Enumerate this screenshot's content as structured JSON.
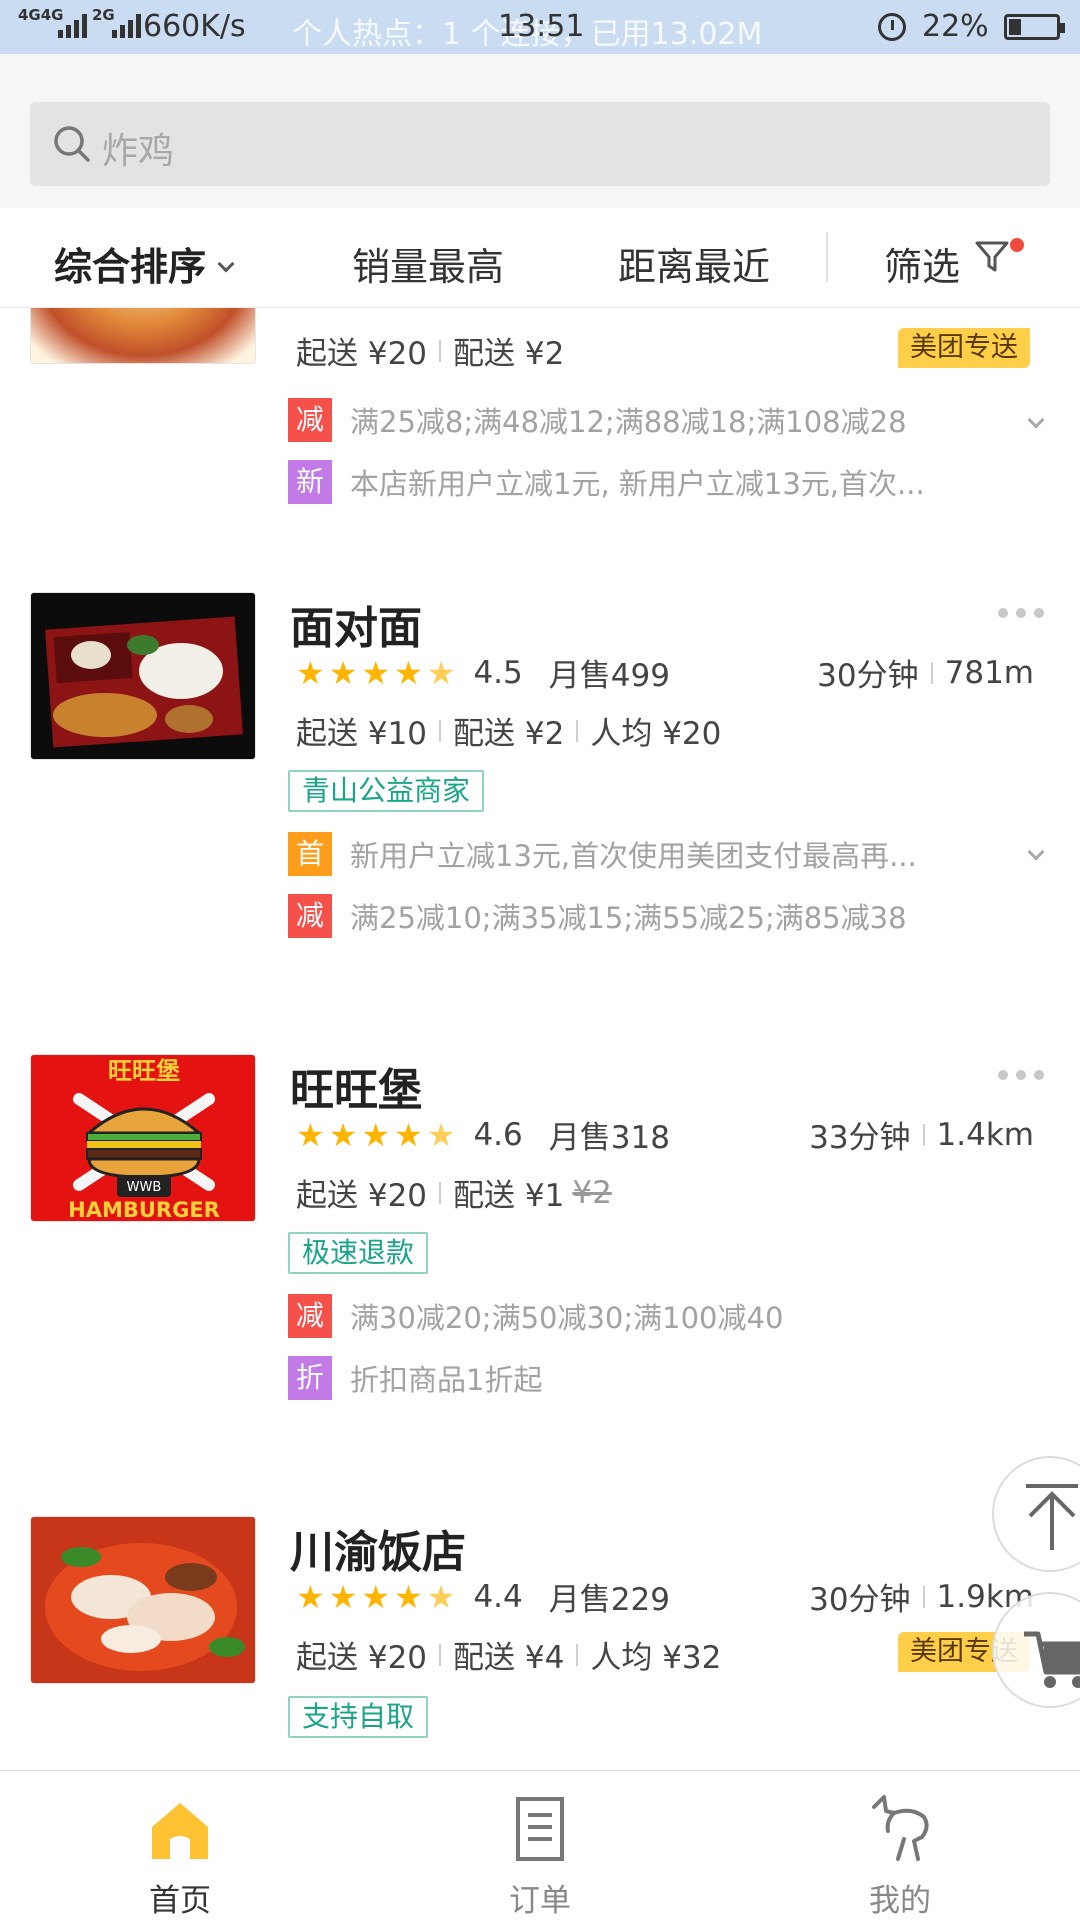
{
  "status_bar": {
    "network": "4G4G",
    "network2": "2G",
    "speed": "660K/s",
    "hotspot": "个人热点：1 个连接，已用13.02M",
    "time": "13:51",
    "battery": "22%"
  },
  "search": {
    "placeholder": "炸鸡"
  },
  "filters": {
    "sort": "综合排序",
    "sales": "销量最高",
    "distance": "距离最近",
    "filter": "筛选"
  },
  "shops": [
    {
      "name": "",
      "min_order": "起送 ¥20",
      "delivery": "配送 ¥2",
      "badge": "美团专送",
      "promos": [
        {
          "icon": "减",
          "text": "满25减8;满48减12;满88减18;满108减28"
        },
        {
          "icon": "新",
          "text": "本店新用户立减1元, 新用户立减13元,首次..."
        }
      ]
    },
    {
      "name": "面对面",
      "rating_value": 4.5,
      "rating": "4.5",
      "monthly_sales": "月售499",
      "time": "30分钟",
      "distance": "781m",
      "min_order": "起送 ¥10",
      "delivery": "配送 ¥2",
      "avg_price": "人均 ¥20",
      "tag": "青山公益商家",
      "promos": [
        {
          "icon": "首",
          "text": "新用户立减13元,首次使用美团支付最高再..."
        },
        {
          "icon": "减",
          "text": "满25减10;满35减15;满55减25;满85减38"
        }
      ]
    },
    {
      "name": "旺旺堡",
      "rating_value": 4.6,
      "rating": "4.6",
      "monthly_sales": "月售318",
      "time": "33分钟",
      "distance": "1.4km",
      "min_order": "起送 ¥20",
      "delivery": "配送 ¥1",
      "delivery_original": "¥2",
      "tag": "极速退款",
      "logo_top": "旺旺堡",
      "logo_mid": "WWB",
      "logo_bottom": "HAMBURGER",
      "promos": [
        {
          "icon": "减",
          "text": "满30减20;满50减30;满100减40"
        },
        {
          "icon": "折",
          "text": "折扣商品1折起"
        }
      ]
    },
    {
      "name": "川渝饭店",
      "rating_value": 4.4,
      "rating": "4.4",
      "monthly_sales": "月售229",
      "time": "30分钟",
      "distance": "1.9km",
      "min_order": "起送 ¥20",
      "delivery": "配送 ¥4",
      "avg_price": "人均 ¥32",
      "badge": "美团专送",
      "tag": "支持自取"
    }
  ],
  "bottom_nav": {
    "home": "首页",
    "orders": "订单",
    "mine": "我的"
  },
  "colors": {
    "accent": "#ffc233",
    "star": "#ffb400",
    "promo_red": "#f5504a",
    "promo_purple": "#c27be6",
    "promo_orange": "#ff9d1a",
    "tag_green": "#1aa58a"
  }
}
